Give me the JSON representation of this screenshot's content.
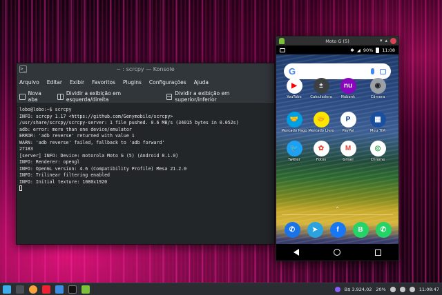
{
  "colors": {
    "desktop": "#0a0208",
    "konsole_bg": "#232629",
    "konsole_chrome": "#31363b",
    "taskbar": "#2a2e32"
  },
  "konsole": {
    "title": "~ : scrcpy — Konsole",
    "menu": [
      "Arquivo",
      "Editar",
      "Exibir",
      "Favoritos",
      "Plugins",
      "Configurações",
      "Ajuda"
    ],
    "toolbar": {
      "new_tab": "Nova aba",
      "split_lr": "Dividir a exibição em esquerda/direita",
      "split_tb": "Dividir a exibição em superior/inferior"
    },
    "lines": [
      "lobo@lobo:~$ scrcpy",
      "INFO: scrcpy 1.17 <https://github.com/Genymobile/scrcpy>",
      "/usr/share/scrcpy/scrcpy-server: 1 file pushed. 0.6 MB/s (34015 bytes in 0.052s)",
      "adb: error: more than one device/emulator",
      "ERROR: 'adb reverse' returned with value 1",
      "WARN: 'adb reverse' failed, fallback to 'adb forward'",
      "27183",
      "[server] INFO: Device: motorola Moto G (5) (Android 8.1.0)",
      "INFO: Renderer: opengl",
      "INFO: OpenGL version: 4.6 (Compatibility Profile) Mesa 21.2.0",
      "INFO: Trilinear filtering enabled",
      "INFO: Initial texture: 1080x1920"
    ]
  },
  "phone": {
    "title": "Moto G (5)",
    "status": {
      "battery": "90%",
      "time": "11:08"
    },
    "search_logo": "G",
    "apps": [
      {
        "label": "YouTube",
        "glyph": "▶",
        "color": "#ffffff",
        "fg": "#ff0000"
      },
      {
        "label": "Calculadora",
        "glyph": "±",
        "color": "#3c4043",
        "fg": "#ffffff"
      },
      {
        "label": "Nubank",
        "glyph": "nu",
        "color": "#8a05be",
        "fg": "#ffffff"
      },
      {
        "label": "Câmera",
        "glyph": "◉",
        "color": "#9aa0a6",
        "fg": "#202124"
      },
      {
        "label": "Mercado Pago",
        "glyph": "🤝",
        "color": "#009ee3",
        "fg": "#ffffff"
      },
      {
        "label": "Mercado Livre",
        "glyph": "🤝",
        "color": "#ffe600",
        "fg": "#2d3277"
      },
      {
        "label": "PayPal",
        "glyph": "P",
        "color": "#ffffff",
        "fg": "#003087"
      },
      {
        "label": "Meu TIM",
        "glyph": "▦",
        "color": "#1a4fa0",
        "fg": "#ffffff"
      },
      {
        "label": "Twitter",
        "glyph": "🐦",
        "color": "#1da1f2",
        "fg": "#ffffff"
      },
      {
        "label": "Fotos",
        "glyph": "✿",
        "color": "#ffffff",
        "fg": "#ea4335"
      },
      {
        "label": "Gmail",
        "glyph": "M",
        "color": "#ffffff",
        "fg": "#ea4335"
      },
      {
        "label": "Chrome",
        "glyph": "◎",
        "color": "#ffffff",
        "fg": "#34a853"
      }
    ],
    "dock": [
      {
        "name": "phone",
        "glyph": "✆",
        "color": "#1a73e8"
      },
      {
        "name": "telegram",
        "glyph": "➤",
        "color": "#2aa3df"
      },
      {
        "name": "facebook",
        "glyph": "f",
        "color": "#1877f2"
      },
      {
        "name": "whatsapp-business",
        "glyph": "B",
        "color": "#25d366"
      },
      {
        "name": "whatsapp",
        "glyph": "✆",
        "color": "#25d366"
      }
    ]
  },
  "taskbar": {
    "price": "B$ 3.924,02",
    "percent": "20%",
    "time": "11:08:47"
  }
}
